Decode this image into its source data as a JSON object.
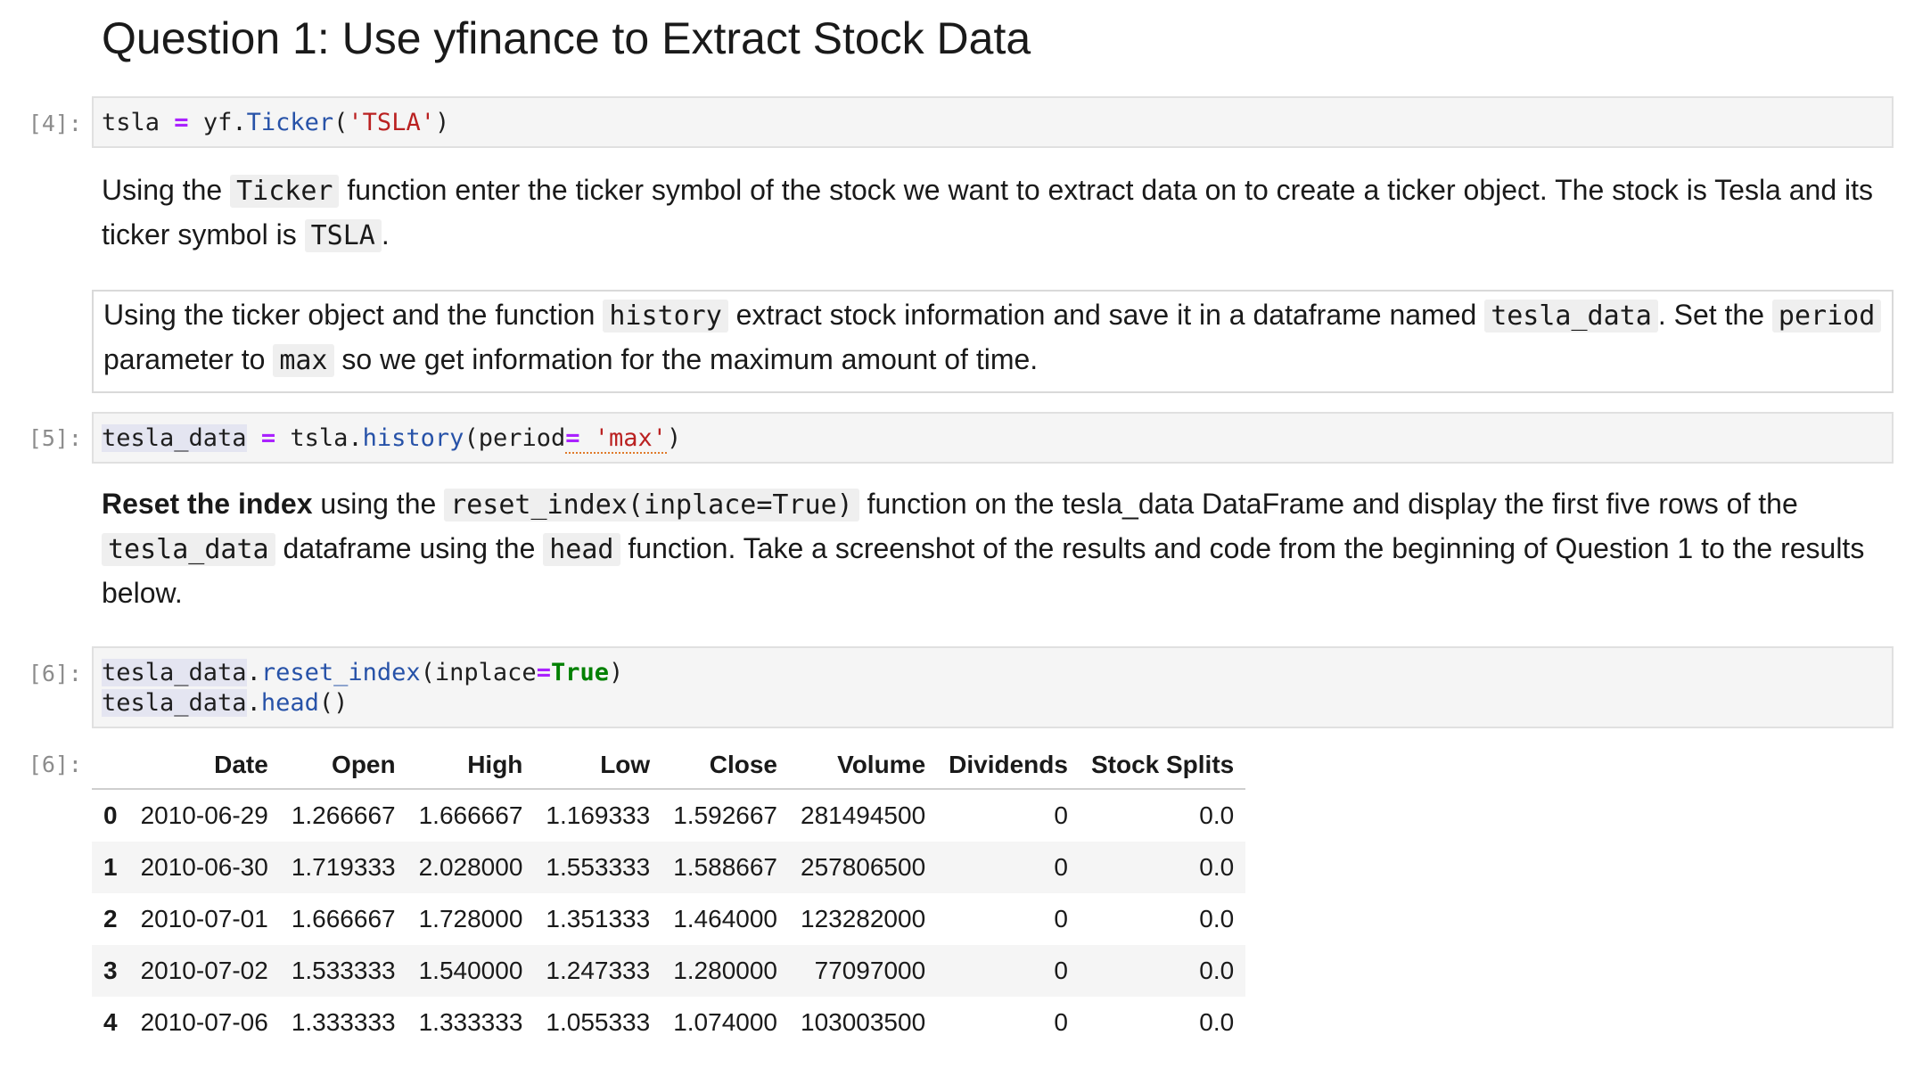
{
  "title": "Question 1: Use yfinance to Extract Stock Data",
  "cell4": {
    "prompt": "[4]:",
    "code": {
      "var": "tsla",
      "eq": "=",
      "obj": "yf.",
      "fn": "Ticker",
      "open": "(",
      "arg": "'TSLA'",
      "close": ")"
    }
  },
  "md1": {
    "p1": "Using the ",
    "c1": "Ticker",
    "p2": " function enter the ticker symbol of the stock we want to extract data on to create a ticker object. The stock is Tesla and its ticker symbol is ",
    "c2": "TSLA",
    "p3": "."
  },
  "md2": {
    "p1": "Using the ticker object and the function ",
    "c1": "history",
    "p2": " extract stock information and save it in a dataframe named ",
    "c2": "tesla_data",
    "p3": ". Set the ",
    "c3": "period",
    "p4": " parameter to ",
    "c4": "max",
    "p5": " so we get information for the maximum amount of time."
  },
  "cell5": {
    "prompt": "[5]:",
    "code": {
      "var": "tesla_data",
      "eq": "=",
      "obj": "tsla.",
      "fn": "history",
      "open": "(period",
      "eq2": "=",
      "arg": " 'max'",
      "close": ")"
    }
  },
  "md3": {
    "b1": "Reset the index",
    "p1": " using the ",
    "c1": "reset_index(inplace=True)",
    "p2": " function on the tesla_data DataFrame and display the first five rows of the ",
    "c2": "tesla_data",
    "p3": " dataframe using the ",
    "c3": "head",
    "p4": " function. Take a screenshot of the results and code from the beginning of Question 1 to the results below."
  },
  "cell6": {
    "prompt": "[6]:",
    "line1": {
      "var": "tesla_data",
      "dot": ".",
      "fn": "reset_index",
      "open": "(inplace",
      "eq": "=",
      "val": "True",
      "close": ")"
    },
    "line2": {
      "var": "tesla_data",
      "dot": ".",
      "fn": "head",
      "tail": "()"
    }
  },
  "output6": {
    "prompt": "[6]:",
    "columns": [
      "",
      "Date",
      "Open",
      "High",
      "Low",
      "Close",
      "Volume",
      "Dividends",
      "Stock Splits"
    ],
    "rows": [
      [
        "0",
        "2010-06-29",
        "1.266667",
        "1.666667",
        "1.169333",
        "1.592667",
        "281494500",
        "0",
        "0.0"
      ],
      [
        "1",
        "2010-06-30",
        "1.719333",
        "2.028000",
        "1.553333",
        "1.588667",
        "257806500",
        "0",
        "0.0"
      ],
      [
        "2",
        "2010-07-01",
        "1.666667",
        "1.728000",
        "1.351333",
        "1.464000",
        "123282000",
        "0",
        "0.0"
      ],
      [
        "3",
        "2010-07-02",
        "1.533333",
        "1.540000",
        "1.247333",
        "1.280000",
        "77097000",
        "0",
        "0.0"
      ],
      [
        "4",
        "2010-07-06",
        "1.333333",
        "1.333333",
        "1.055333",
        "1.074000",
        "103003500",
        "0",
        "0.0"
      ]
    ]
  }
}
